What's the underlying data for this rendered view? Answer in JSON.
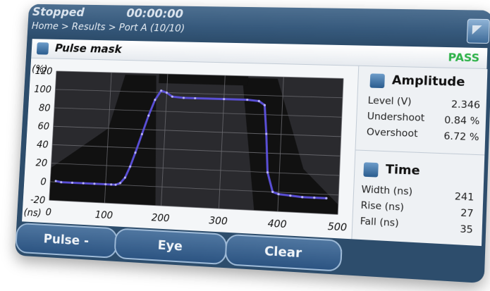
{
  "header": {
    "status": "Stopped",
    "timer": "00:00:00",
    "breadcrumb": "Home > Results > Port A (10/10)"
  },
  "panel": {
    "title": "Pulse mask",
    "result": "PASS"
  },
  "chart_data": {
    "type": "line",
    "ylabel": "(%)",
    "xlabel": "(ns)",
    "xlim": [
      0,
      500
    ],
    "ylim": [
      -20,
      120
    ],
    "xticks": [
      0,
      100,
      200,
      300,
      400,
      500
    ],
    "yticks": [
      120,
      100,
      80,
      60,
      40,
      20,
      0,
      -20
    ],
    "grid": true,
    "series": [
      {
        "color": "#5a4fd6",
        "x": [
          10,
          20,
          40,
          60,
          80,
          100,
          110,
          118,
          126,
          134,
          142,
          150,
          160,
          170,
          180,
          190,
          200,
          210,
          230,
          250,
          300,
          340,
          360,
          370,
          375,
          380,
          390,
          400,
          420,
          440,
          460,
          480
        ],
        "y": [
          1,
          0,
          0,
          0,
          0,
          0,
          0,
          0,
          2,
          8,
          20,
          35,
          55,
          75,
          92,
          102,
          100,
          96,
          95,
          95,
          95,
          95,
          94,
          90,
          60,
          20,
          0,
          -2,
          -3,
          -4,
          -4,
          -4
        ]
      }
    ],
    "mask_color": "#111111"
  },
  "amplitude": {
    "title": "Amplitude",
    "rows": [
      {
        "label": "Level (V)",
        "value": "2.346"
      },
      {
        "label": "Undershoot",
        "value": "0.84 %"
      },
      {
        "label": "Overshoot",
        "value": "6.72 %"
      }
    ]
  },
  "time": {
    "title": "Time",
    "rows": [
      {
        "label": "Width (ns)",
        "value": "241"
      },
      {
        "label": "Rise (ns)",
        "value": "27"
      },
      {
        "label": "Fall (ns)",
        "value": "35"
      }
    ]
  },
  "buttons": {
    "pulse": "Pulse -",
    "eye": "Eye",
    "clear": "Clear"
  }
}
